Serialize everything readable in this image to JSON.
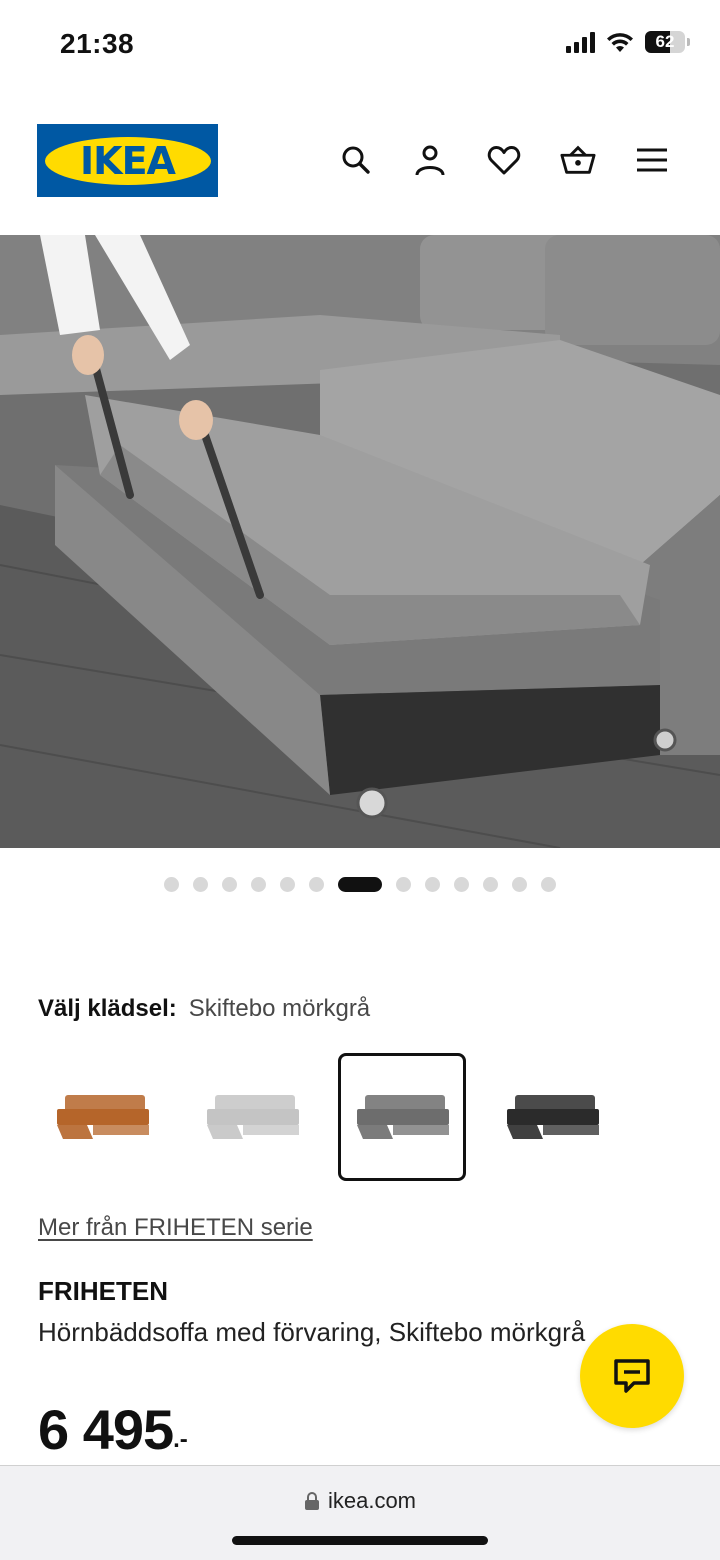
{
  "status_bar": {
    "time": "21:38",
    "battery": "62",
    "battery_level": 0.62
  },
  "header": {
    "logo_text": "IKEA",
    "icons": [
      "search-icon",
      "profile-icon",
      "heart-icon",
      "cart-icon",
      "menu-icon"
    ]
  },
  "carousel": {
    "dot_count": 13,
    "active_index": 6
  },
  "upholstery": {
    "label": "Välj klädsel:",
    "value": "Skiftebo mörkgrå",
    "options": [
      {
        "color": "#b5652a"
      },
      {
        "color": "#c4c4c4"
      },
      {
        "color": "#6d6d6d",
        "selected": true
      },
      {
        "color": "#2b2b2b"
      }
    ]
  },
  "series_link": "Mer från FRIHETEN serie",
  "product": {
    "name": "FRIHETEN",
    "description": "Hörnbäddsoffa med förvaring, Skiftebo mörkgrå",
    "price": "6 495",
    "price_suffix": ".-"
  },
  "browser": {
    "url": "ikea.com"
  },
  "colors": {
    "ikea_blue": "#0058a3",
    "ikea_yellow": "#ffdb00"
  }
}
